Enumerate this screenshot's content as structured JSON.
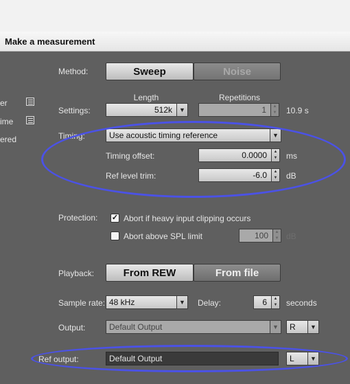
{
  "window": {
    "title": "Make a measurement"
  },
  "side": {
    "label1": "er",
    "label2": "ime",
    "label3": "ered"
  },
  "method": {
    "label": "Method:",
    "sweep": "Sweep",
    "noise": "Noise"
  },
  "settings": {
    "label": "Settings:",
    "length_header": "Length",
    "repetitions_header": "Repetitions",
    "length_value": "512k",
    "repetitions_value": "1",
    "duration": "10.9 s"
  },
  "timing": {
    "label": "Timing:",
    "mode": "Use acoustic timing reference",
    "offset_label": "Timing offset:",
    "offset_value": "0.0000",
    "offset_unit": "ms",
    "trim_label": "Ref level trim:",
    "trim_value": "-6.0",
    "trim_unit": "dB"
  },
  "protection": {
    "label": "Protection:",
    "abort_clipping": "Abort if heavy input clipping occurs",
    "abort_clipping_checked": true,
    "abort_spl": "Abort above SPL limit",
    "abort_spl_checked": false,
    "spl_value": "100",
    "spl_unit": "dB"
  },
  "playback": {
    "label": "Playback:",
    "from_rew": "From REW",
    "from_file": "From file"
  },
  "sample_rate": {
    "label": "Sample rate:",
    "value": "48 kHz",
    "delay_label": "Delay:",
    "delay_value": "6",
    "delay_unit": "seconds"
  },
  "output": {
    "label": "Output:",
    "device": "Default Output",
    "channel": "R"
  },
  "ref_output": {
    "label": "Ref output:",
    "device": "Default Output",
    "channel": "L"
  },
  "colors": {
    "annotation": "#4b52e6"
  }
}
